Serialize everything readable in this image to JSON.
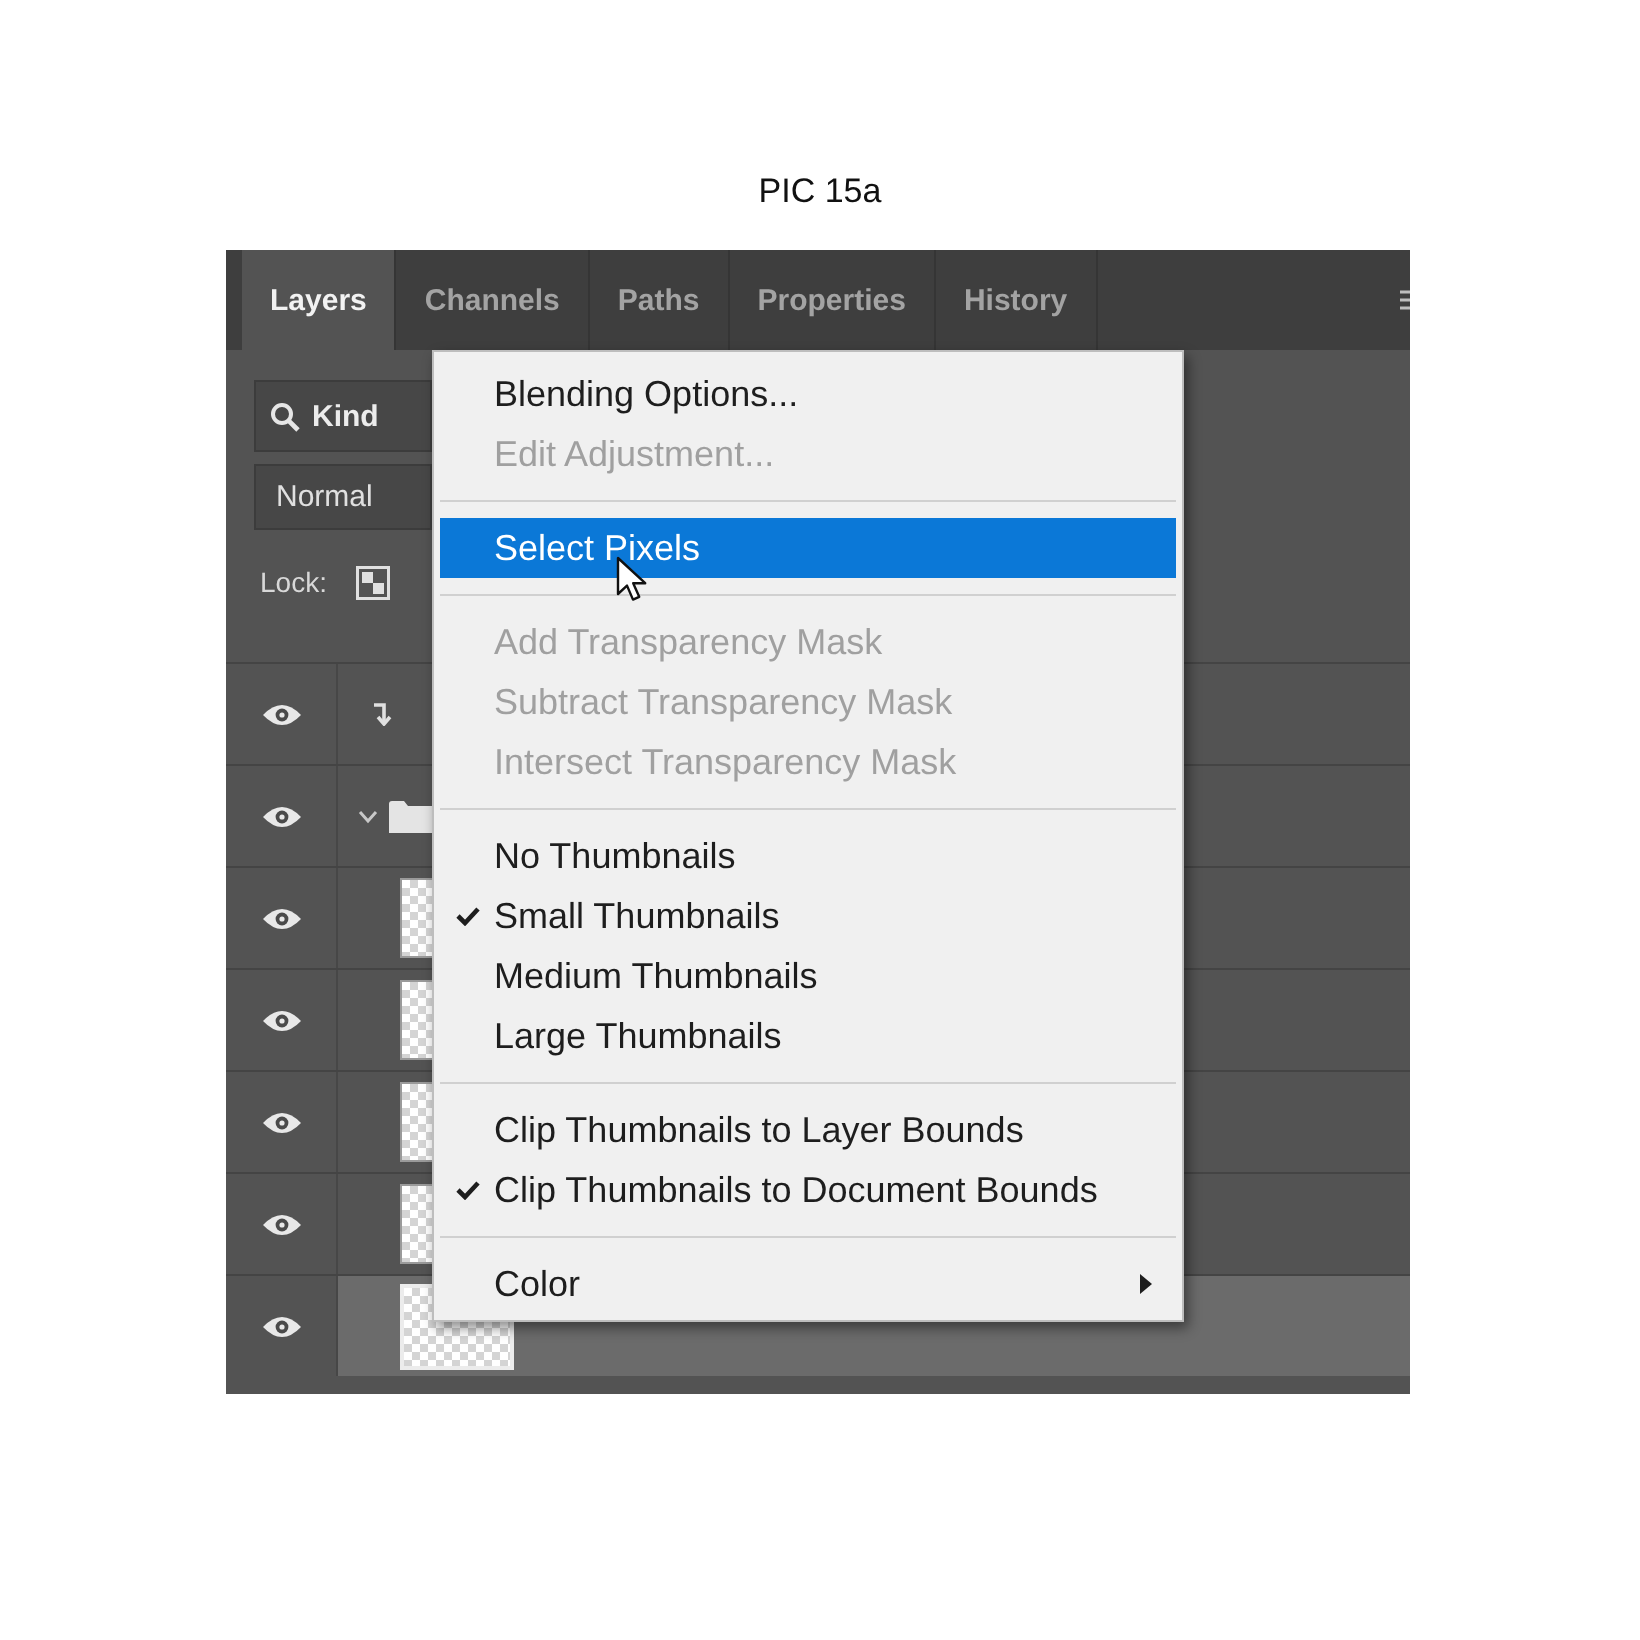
{
  "caption": "PIC 15a",
  "panel": {
    "tabs": [
      {
        "label": "Layers",
        "selected": true
      },
      {
        "label": "Channels",
        "selected": false
      },
      {
        "label": "Paths",
        "selected": false
      },
      {
        "label": "Properties",
        "selected": false
      },
      {
        "label": "History",
        "selected": false
      }
    ],
    "filter": {
      "value": "Kind"
    },
    "blend_mode": {
      "value": "Normal"
    },
    "lock": {
      "label": "Lock:"
    },
    "layers": [
      {
        "kind": "clipped",
        "visible": true,
        "selected": false
      },
      {
        "kind": "group",
        "visible": true,
        "selected": false,
        "expanded": true
      },
      {
        "kind": "layer",
        "visible": true,
        "selected": false
      },
      {
        "kind": "layer",
        "visible": true,
        "selected": false
      },
      {
        "kind": "layer",
        "visible": true,
        "selected": false
      },
      {
        "kind": "layer",
        "visible": true,
        "selected": false
      },
      {
        "kind": "layer",
        "visible": true,
        "selected": true
      }
    ]
  },
  "context_menu": {
    "items": [
      {
        "kind": "item",
        "label": "Blending Options...",
        "disabled": false,
        "checked": false,
        "selected": false
      },
      {
        "kind": "item",
        "label": "Edit Adjustment...",
        "disabled": true,
        "checked": false,
        "selected": false
      },
      {
        "kind": "separator"
      },
      {
        "kind": "item",
        "label": "Select Pixels",
        "disabled": false,
        "checked": false,
        "selected": true
      },
      {
        "kind": "separator"
      },
      {
        "kind": "item",
        "label": "Add Transparency Mask",
        "disabled": true,
        "checked": false,
        "selected": false
      },
      {
        "kind": "item",
        "label": "Subtract Transparency Mask",
        "disabled": true,
        "checked": false,
        "selected": false
      },
      {
        "kind": "item",
        "label": "Intersect Transparency Mask",
        "disabled": true,
        "checked": false,
        "selected": false
      },
      {
        "kind": "separator"
      },
      {
        "kind": "item",
        "label": "No Thumbnails",
        "disabled": false,
        "checked": false,
        "selected": false
      },
      {
        "kind": "item",
        "label": "Small Thumbnails",
        "disabled": false,
        "checked": true,
        "selected": false
      },
      {
        "kind": "item",
        "label": "Medium Thumbnails",
        "disabled": false,
        "checked": false,
        "selected": false
      },
      {
        "kind": "item",
        "label": "Large Thumbnails",
        "disabled": false,
        "checked": false,
        "selected": false
      },
      {
        "kind": "separator"
      },
      {
        "kind": "item",
        "label": "Clip Thumbnails to Layer Bounds",
        "disabled": false,
        "checked": false,
        "selected": false
      },
      {
        "kind": "item",
        "label": "Clip Thumbnails to Document Bounds",
        "disabled": false,
        "checked": true,
        "selected": false
      },
      {
        "kind": "separator"
      },
      {
        "kind": "submenu",
        "label": "Color",
        "disabled": false,
        "checked": false,
        "selected": false
      }
    ]
  }
}
